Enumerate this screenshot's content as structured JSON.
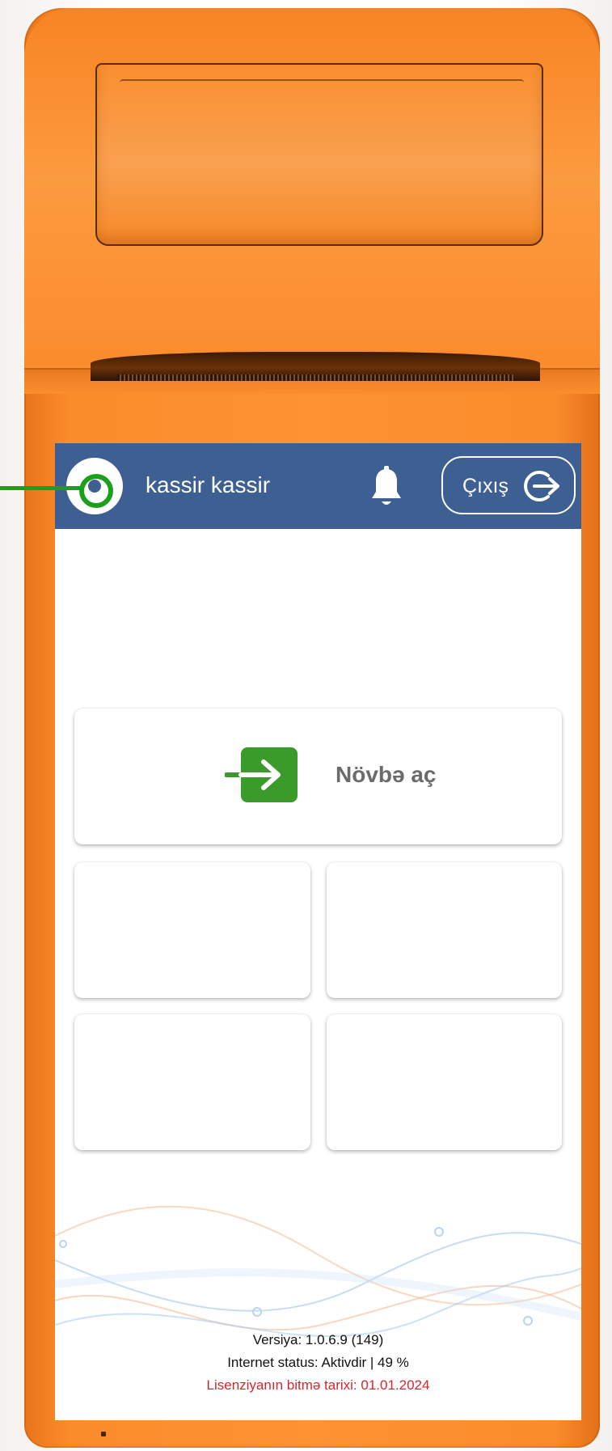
{
  "header": {
    "username": "kassir kassir",
    "logout_label": "Çıxış",
    "background_color": "#3d5f92"
  },
  "icons": {
    "avatar": "user-avatar-icon",
    "notifications": "bell-icon",
    "logout": "logout-arrow-icon",
    "open_shift": "enter-arrow-icon"
  },
  "actions": {
    "open_shift_label": "Növbə aç",
    "open_shift_icon_color": "#3a9a2a"
  },
  "footer": {
    "version": "Versiya: 1.0.6.9 (149)",
    "internet_status": "Internet status: Aktivdir | 49 %",
    "license_expiry": "Lisenziyanın bitmə tarixi: 01.01.2024",
    "license_color": "#d8262c"
  },
  "device": {
    "body_color": "#fb8c2c"
  }
}
